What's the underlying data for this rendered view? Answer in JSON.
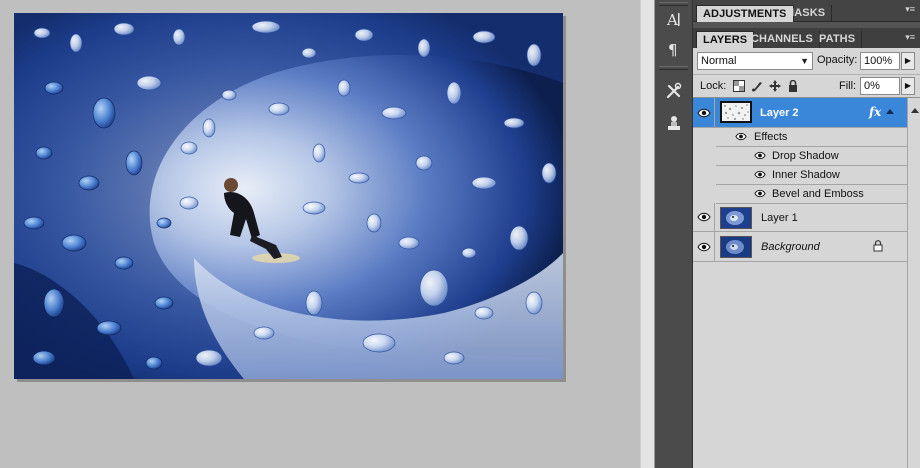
{
  "panels": {
    "top_tabs": [
      {
        "label": "ADJUSTMENTS",
        "active": true
      },
      {
        "label": "MASKS",
        "active": false
      }
    ],
    "layers_tabs": [
      {
        "label": "LAYERS",
        "active": true
      },
      {
        "label": "CHANNELS",
        "active": false
      },
      {
        "label": "PATHS",
        "active": false
      }
    ],
    "panel_menu_icon": "panel-menu-icon"
  },
  "layers_panel": {
    "blend_mode": "Normal",
    "opacity_label": "Opacity:",
    "opacity_value": "100%",
    "lock_label": "Lock:",
    "fill_label": "Fill:",
    "fill_value": "0%",
    "layers": [
      {
        "name": "Layer 2",
        "selected": true,
        "visible": true,
        "fx": "fx"
      },
      {
        "name": "Layer 1",
        "selected": false,
        "visible": true
      },
      {
        "name": "Background",
        "selected": false,
        "visible": true,
        "locked": true
      }
    ],
    "effects_header": "Effects",
    "effects": [
      "Drop Shadow",
      "Inner Shadow",
      "Bevel and Emboss"
    ]
  },
  "tools": [
    "character-icon",
    "paragraph-icon",
    "tools-icon",
    "stamp-icon"
  ],
  "colors": {
    "selected_layer": "#3a87d9",
    "panel_bg": "#d6d6d6",
    "dark_chrome": "#3f3f3f",
    "canvas_bg": "#bfbfbf"
  }
}
